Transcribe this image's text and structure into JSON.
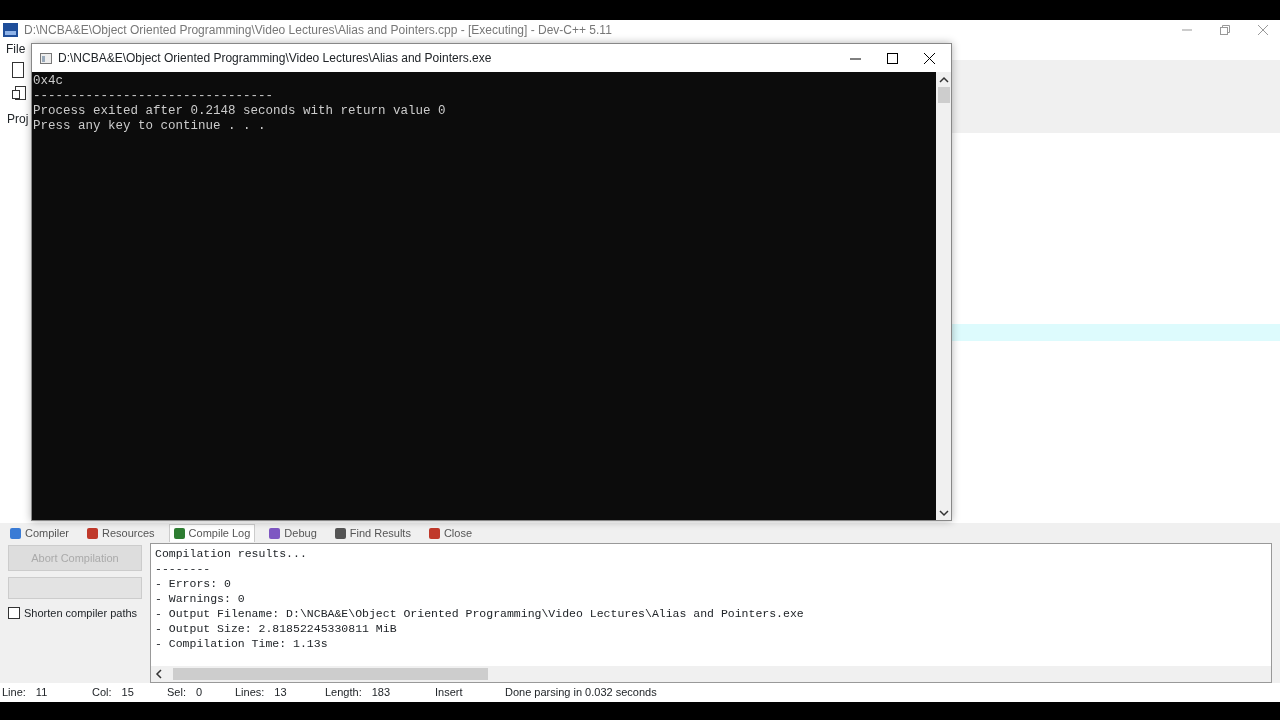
{
  "ide": {
    "title": "D:\\NCBA&E\\Object Oriented Programming\\Video Lectures\\Alias and Pointers.cpp - [Executing] - Dev-C++ 5.11",
    "menu": [
      "File"
    ],
    "side_tab": "Proj"
  },
  "console": {
    "title": "D:\\NCBA&E\\Object Oriented Programming\\Video Lectures\\Alias and Pointers.exe",
    "lines": [
      "0x4c",
      "--------------------------------",
      "Process exited after 0.2148 seconds with return value 0",
      "Press any key to continue . . ."
    ]
  },
  "bottom_tabs": [
    {
      "label": "Compiler",
      "selected": false
    },
    {
      "label": "Resources",
      "selected": false
    },
    {
      "label": "Compile Log",
      "selected": true
    },
    {
      "label": "Debug",
      "selected": false
    },
    {
      "label": "Find Results",
      "selected": false
    },
    {
      "label": "Close",
      "selected": false
    }
  ],
  "abort_button": {
    "label": "Abort Compilation",
    "disabled": true
  },
  "progress": {
    "level": 0
  },
  "shorten_paths": {
    "label": "Shorten compiler paths",
    "checked": false
  },
  "log_lines": [
    "Compilation results...",
    "--------",
    "- Errors: 0",
    "- Warnings: 0",
    "- Output Filename: D:\\NCBA&E\\Object Oriented Programming\\Video Lectures\\Alias and Pointers.exe",
    "- Output Size: 2.81852245330811 MiB",
    "- Compilation Time: 1.13s"
  ],
  "status_bar": [
    {
      "label": "Line:",
      "value": "11"
    },
    {
      "label": "Col:",
      "value": "15"
    },
    {
      "label": "Sel:",
      "value": "0"
    },
    {
      "label": "Lines:",
      "value": "13"
    },
    {
      "label": "Length:",
      "value": "183"
    },
    {
      "label": "Insert"
    },
    {
      "label": "Done parsing in 0.032 seconds"
    }
  ]
}
